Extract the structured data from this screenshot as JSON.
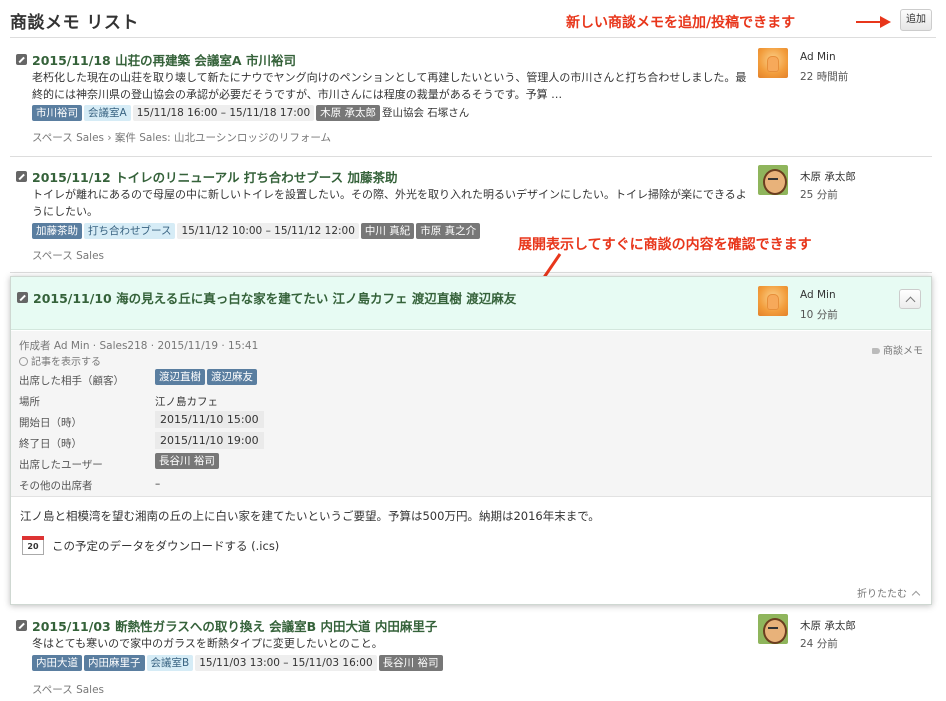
{
  "header": {
    "title": "商談メモ リスト",
    "annotation_add": "新しい商談メモを追加/投稿できます",
    "add_button": "追加"
  },
  "annotation_expand": "展開表示してすぐに商談の内容を確認できます",
  "entries": [
    {
      "title": "2015/11/18 山荘の再建築 会議室A 市川裕司",
      "body": "老朽化した現在の山荘を取り壊して新たにナウでヤング向けのペンションとして再建したいという、管理人の市川さんと打ち合わせしました。最終的には神奈川県の登山協会の承認が必要だそうですが、市川さんには程度の裁量があるそうです。予算 …",
      "tags": [
        "市川裕司",
        "会議室A",
        "15/11/18 16:00 – 15/11/18 17:00",
        "木原 承太郎",
        "登山協会 石塚さん"
      ],
      "meta": "スペース Sales › 案件 Sales: 山北ユーシンロッジのリフォーム",
      "user": "Ad Min",
      "time": "22 時間前"
    },
    {
      "title": "2015/11/12 トイレのリニューアル 打ち合わせブース 加藤茶助",
      "body": "トイレが離れにあるので母屋の中に新しいトイレを設置したい。その際、外光を取り入れた明るいデザインにしたい。トイレ掃除が楽にできるようにしたい。",
      "tags": [
        "加藤茶助",
        "打ち合わせブース",
        "15/11/12 10:00 – 15/11/12 12:00",
        "中川 真紀",
        "市原 真之介"
      ],
      "meta": "スペース Sales",
      "user": "木原 承太郎",
      "time": "25 分前"
    },
    {
      "title": "2015/11/03 断熱性ガラスへの取り換え 会議室B 内田大道 内田麻里子",
      "body": "冬はとても寒いので家中のガラスを断熱タイプに変更したいとのこと。",
      "tags": [
        "内田大道",
        "内田麻里子",
        "会議室B",
        "15/11/03 13:00 – 15/11/03 16:00",
        "長谷川 裕司"
      ],
      "meta": "スペース Sales",
      "user": "木原 承太郎",
      "time": "24 分前"
    }
  ],
  "expanded": {
    "title": "2015/11/10 海の見える丘に真っ白な家を建てたい 江ノ島カフェ 渡辺直樹 渡辺麻友",
    "user": "Ad Min",
    "time": "10 分前",
    "author_line": "作成者 Ad Min · Sales218 · 2015/11/19 · 15:41",
    "show_article": "記事を表示する",
    "category": "商談メモ",
    "fields": {
      "attendees_label": "出席した相手（顧客）",
      "attendees": [
        "渡辺直樹",
        "渡辺麻友"
      ],
      "place_label": "場所",
      "place": "江ノ島カフェ",
      "start_label": "開始日（時）",
      "start": "2015/11/10 15:00",
      "end_label": "終了日（時）",
      "end": "2015/11/10 19:00",
      "users_label": "出席したユーザー",
      "users": [
        "長谷川 裕司"
      ],
      "others_label": "その他の出席者",
      "others": "–"
    },
    "body": "江ノ島と相模湾を望む湘南の丘の上に白い家を建てたいというご要望。予算は500万円。納期は2016年末まで。",
    "download_icon_text": "20",
    "download": "この予定のデータをダウンロードする (.ics)",
    "fold": "折りたたむ"
  },
  "colors": {
    "annotation": "#e8361b",
    "title_green": "#35623a",
    "expanded_header_bg": "#e7fbf3",
    "tag_blue": "#5a7ea0"
  }
}
